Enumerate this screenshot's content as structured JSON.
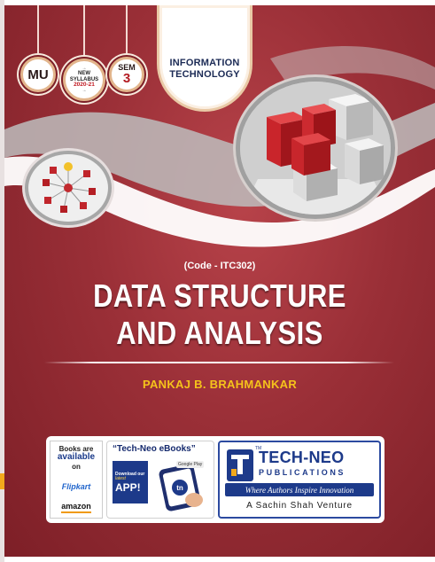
{
  "colors": {
    "cover_bg": "#9a2f37",
    "title_text": "#ffffff",
    "author_text": "#f5c31b",
    "publisher_blue": "#1d3a8a",
    "badge_ring": "#e2b58c"
  },
  "badges": {
    "university": "MU",
    "syllabus_line1": "→",
    "syllabus_line2": "NEW",
    "syllabus_line3": "SYLLABUS",
    "syllabus_line4": "2020-21",
    "syllabus_line5": "→",
    "semester_label": "SEM",
    "semester_number": "3"
  },
  "branch": {
    "line1": "INFORMATION",
    "line2": "TECHNOLOGY"
  },
  "book": {
    "code": "(Code - ITC302)",
    "title_line1": "DATA STRUCTURE",
    "title_line2": "AND ANALYSIS",
    "author": "PANKAJ B. BRAHMANKAR"
  },
  "availability": {
    "line1": "Books are",
    "line2": "available",
    "line3": "on",
    "store1": "Flipkart",
    "store2": "amazon"
  },
  "ebooks": {
    "heading": "“Tech-Neo eBooks”",
    "download_line1": "Download our",
    "download_line2": "latest",
    "app_word": "APP!",
    "store_badge": "Google Play"
  },
  "publisher": {
    "name": "TECH-NEO",
    "division": "PUBLICATIONS",
    "tagline": "Where Authors Inspire Innovation",
    "venture": "A Sachin Shah Venture",
    "tm": "TM"
  },
  "icons": {
    "network": "network-nodes-icon",
    "blocks": "3d-blocks-illustration",
    "phone": "phone-app-icon",
    "logo": "tech-neo-logo-icon"
  }
}
